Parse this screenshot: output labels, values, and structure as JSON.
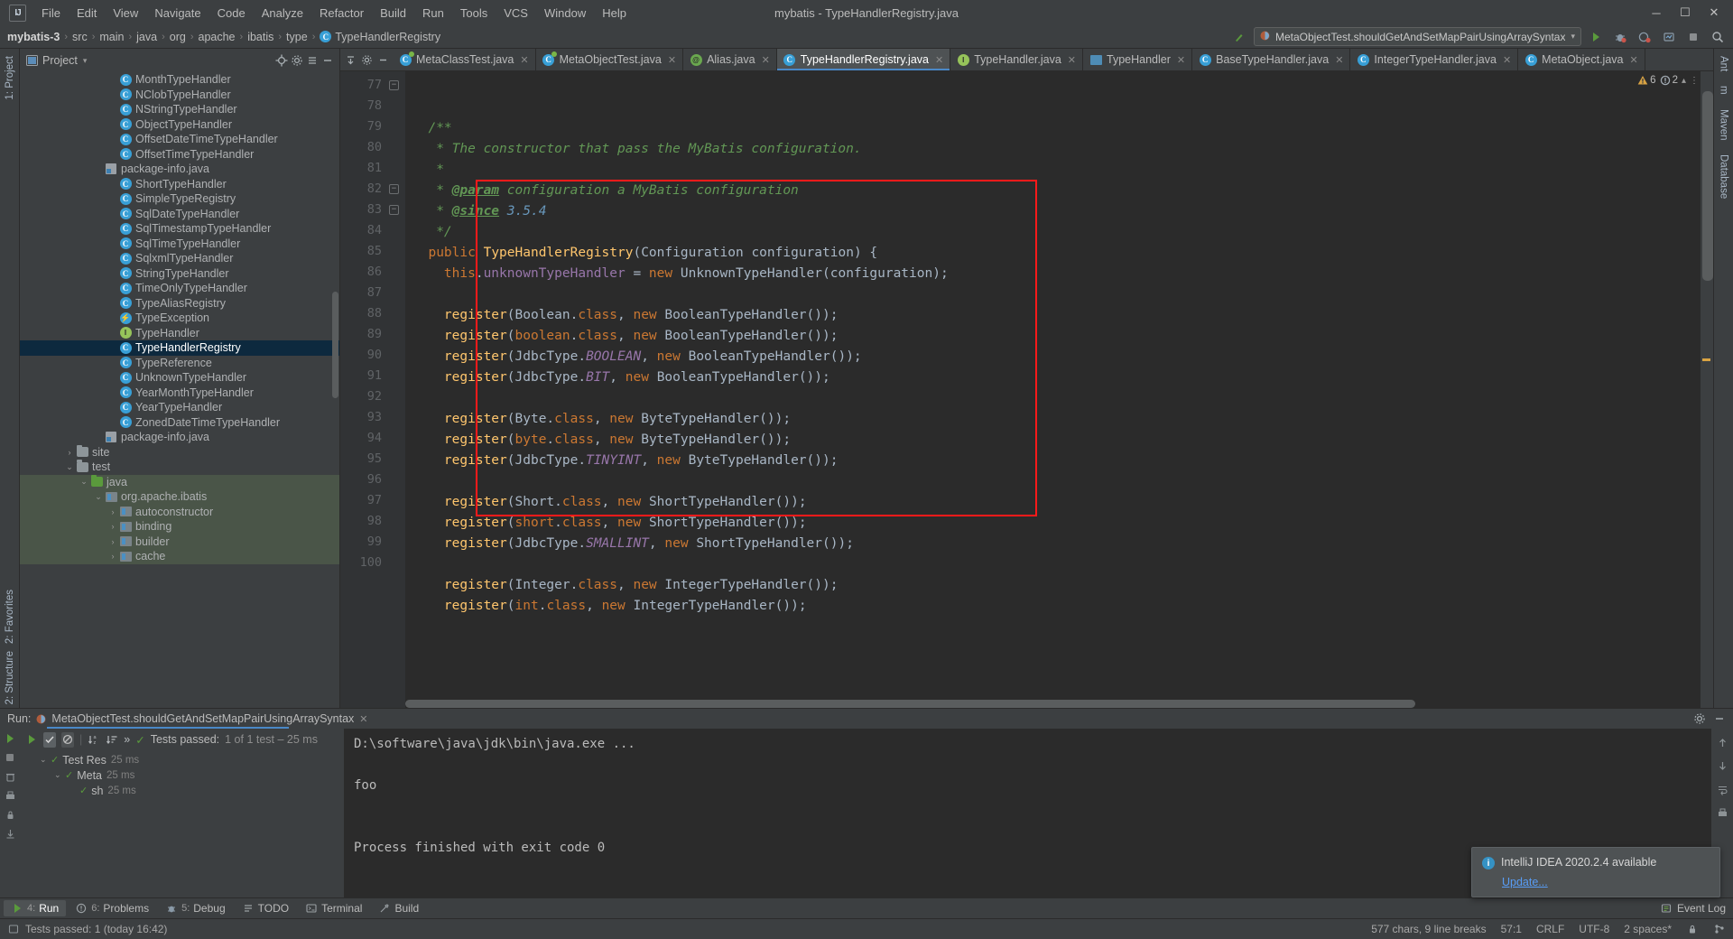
{
  "window": {
    "title": "mybatis - TypeHandlerRegistry.java",
    "logo": "IJ",
    "minimize": "─",
    "maximize": "☐",
    "close": "✕"
  },
  "menu": {
    "items": [
      "File",
      "Edit",
      "View",
      "Navigate",
      "Code",
      "Analyze",
      "Refactor",
      "Build",
      "Run",
      "Tools",
      "VCS",
      "Window",
      "Help"
    ]
  },
  "breadcrumb": {
    "items": [
      "mybatis-3",
      "src",
      "main",
      "java",
      "org",
      "apache",
      "ibatis",
      "type",
      "TypeHandlerRegistry"
    ],
    "separator": "›"
  },
  "run_config": {
    "name": "MetaObjectTest.shouldGetAndSetMapPairUsingArraySyntax",
    "caret": "▾",
    "run_icon": "run-icon",
    "debug_icon": "debug-icon",
    "coverage_icon": "coverage-icon",
    "profile_icon": "profile-icon",
    "stop_icon": "stop-icon",
    "search_icon": "search-icon"
  },
  "left_rail": {
    "top": [
      "1: Project"
    ],
    "bottom": [
      "2: Structure",
      "2: Favorites"
    ]
  },
  "right_rail": {
    "items": [
      "Ant",
      "m",
      "Maven",
      "Database"
    ]
  },
  "project_panel": {
    "title": "Project",
    "caret": "▾",
    "target_icon": "locate-icon",
    "settings_icon": "gear-icon",
    "collapse_icon": "collapse-all-icon",
    "hide_icon": "hide-icon",
    "tree": [
      {
        "label": "MonthTypeHandler",
        "icon": "class",
        "indent": 6,
        "arrow": ""
      },
      {
        "label": "NClobTypeHandler",
        "icon": "class",
        "indent": 6,
        "arrow": ""
      },
      {
        "label": "NStringTypeHandler",
        "icon": "class",
        "indent": 6,
        "arrow": ""
      },
      {
        "label": "ObjectTypeHandler",
        "icon": "class",
        "indent": 6,
        "arrow": ""
      },
      {
        "label": "OffsetDateTimeTypeHandler",
        "icon": "class",
        "indent": 6,
        "arrow": ""
      },
      {
        "label": "OffsetTimeTypeHandler",
        "icon": "class",
        "indent": 6,
        "arrow": ""
      },
      {
        "label": "package-info.java",
        "icon": "pkgjava",
        "indent": 5,
        "arrow": ""
      },
      {
        "label": "ShortTypeHandler",
        "icon": "class",
        "indent": 6,
        "arrow": ""
      },
      {
        "label": "SimpleTypeRegistry",
        "icon": "class",
        "indent": 6,
        "arrow": ""
      },
      {
        "label": "SqlDateTypeHandler",
        "icon": "class",
        "indent": 6,
        "arrow": ""
      },
      {
        "label": "SqlTimestampTypeHandler",
        "icon": "class",
        "indent": 6,
        "arrow": ""
      },
      {
        "label": "SqlTimeTypeHandler",
        "icon": "class",
        "indent": 6,
        "arrow": ""
      },
      {
        "label": "SqlxmlTypeHandler",
        "icon": "class",
        "indent": 6,
        "arrow": ""
      },
      {
        "label": "StringTypeHandler",
        "icon": "class",
        "indent": 6,
        "arrow": ""
      },
      {
        "label": "TimeOnlyTypeHandler",
        "icon": "class",
        "indent": 6,
        "arrow": ""
      },
      {
        "label": "TypeAliasRegistry",
        "icon": "class",
        "indent": 6,
        "arrow": ""
      },
      {
        "label": "TypeException",
        "icon": "exception",
        "indent": 6,
        "arrow": ""
      },
      {
        "label": "TypeHandler",
        "icon": "interface",
        "indent": 6,
        "arrow": ""
      },
      {
        "label": "TypeHandlerRegistry",
        "icon": "class",
        "indent": 6,
        "arrow": "",
        "selected": true
      },
      {
        "label": "TypeReference",
        "icon": "class",
        "indent": 6,
        "arrow": ""
      },
      {
        "label": "UnknownTypeHandler",
        "icon": "class",
        "indent": 6,
        "arrow": ""
      },
      {
        "label": "YearMonthTypeHandler",
        "icon": "class",
        "indent": 6,
        "arrow": ""
      },
      {
        "label": "YearTypeHandler",
        "icon": "class",
        "indent": 6,
        "arrow": ""
      },
      {
        "label": "ZonedDateTimeTypeHandler",
        "icon": "class",
        "indent": 6,
        "arrow": ""
      },
      {
        "label": "package-info.java",
        "icon": "pkgjava",
        "indent": 5,
        "arrow": ""
      },
      {
        "label": "site",
        "icon": "folder",
        "indent": 3,
        "arrow": "›"
      },
      {
        "label": "test",
        "icon": "folder",
        "indent": 3,
        "arrow": "⌄"
      },
      {
        "label": "java",
        "icon": "folder-green",
        "indent": 4,
        "arrow": "⌄",
        "srcroot": true
      },
      {
        "label": "org.apache.ibatis",
        "icon": "pkg",
        "indent": 5,
        "arrow": "⌄",
        "srcroot": true
      },
      {
        "label": "autoconstructor",
        "icon": "pkg",
        "indent": 6,
        "arrow": "›",
        "srcroot": true
      },
      {
        "label": "binding",
        "icon": "pkg",
        "indent": 6,
        "arrow": "›",
        "srcroot": true
      },
      {
        "label": "builder",
        "icon": "pkg",
        "indent": 6,
        "arrow": "›",
        "srcroot": true
      },
      {
        "label": "cache",
        "icon": "pkg",
        "indent": 6,
        "arrow": "›",
        "srcroot": true
      }
    ]
  },
  "editor": {
    "tabs": [
      {
        "label": "MetaClassTest.java",
        "icon": "test-class",
        "active": false
      },
      {
        "label": "MetaObjectTest.java",
        "icon": "test-class",
        "active": false
      },
      {
        "label": "Alias.java",
        "icon": "annotation",
        "active": false
      },
      {
        "label": "TypeHandlerRegistry.java",
        "icon": "class",
        "active": true
      },
      {
        "label": "TypeHandler.java",
        "icon": "interface",
        "active": false
      },
      {
        "label": "TypeHandler",
        "icon": "xml",
        "active": false
      },
      {
        "label": "BaseTypeHandler.java",
        "icon": "class",
        "active": false
      },
      {
        "label": "IntegerTypeHandler.java",
        "icon": "class",
        "active": false
      },
      {
        "label": "MetaObject.java",
        "icon": "class",
        "active": false
      }
    ],
    "tab_close": "✕",
    "inspections": {
      "warnings": "6",
      "weak_warnings": "2",
      "ok_mark": "✓"
    },
    "line_numbers": [
      "77",
      "78",
      "79",
      "80",
      "81",
      "82",
      "83",
      "84",
      "85",
      "86",
      "87",
      "88",
      "89",
      "90",
      "91",
      "92",
      "93",
      "94",
      "95",
      "96",
      "97",
      "98",
      "99",
      "100"
    ],
    "lines": [
      {
        "n": "77",
        "text": "  /**"
      },
      {
        "n": "78",
        "text": "   * The constructor that pass the MyBatis configuration."
      },
      {
        "n": "79",
        "text": "   *"
      },
      {
        "n": "80",
        "text": "   * @param configuration a MyBatis configuration"
      },
      {
        "n": "81",
        "text": "   * @since 3.5.4"
      },
      {
        "n": "82",
        "text": "   */"
      },
      {
        "n": "83",
        "text": "  public TypeHandlerRegistry(Configuration configuration) {"
      },
      {
        "n": "84",
        "text": "    this.unknownTypeHandler = new UnknownTypeHandler(configuration);"
      },
      {
        "n": "85",
        "text": ""
      },
      {
        "n": "86",
        "text": "    register(Boolean.class, new BooleanTypeHandler());"
      },
      {
        "n": "87",
        "text": "    register(boolean.class, new BooleanTypeHandler());"
      },
      {
        "n": "88",
        "text": "    register(JdbcType.BOOLEAN, new BooleanTypeHandler());"
      },
      {
        "n": "89",
        "text": "    register(JdbcType.BIT, new BooleanTypeHandler());"
      },
      {
        "n": "90",
        "text": ""
      },
      {
        "n": "91",
        "text": "    register(Byte.class, new ByteTypeHandler());"
      },
      {
        "n": "92",
        "text": "    register(byte.class, new ByteTypeHandler());"
      },
      {
        "n": "93",
        "text": "    register(JdbcType.TINYINT, new ByteTypeHandler());"
      },
      {
        "n": "94",
        "text": ""
      },
      {
        "n": "95",
        "text": "    register(Short.class, new ShortTypeHandler());"
      },
      {
        "n": "96",
        "text": "    register(short.class, new ShortTypeHandler());"
      },
      {
        "n": "97",
        "text": "    register(JdbcType.SMALLINT, new ShortTypeHandler());"
      },
      {
        "n": "98",
        "text": ""
      },
      {
        "n": "99",
        "text": "    register(Integer.class, new IntegerTypeHandler());"
      },
      {
        "n": "100",
        "text": "    register(int.class, new IntegerTypeHandler());"
      }
    ]
  },
  "run_panel": {
    "label": "Run:",
    "config_name": "MetaObjectTest.shouldGetAndSetMapPairUsingArraySyntax",
    "close": "✕",
    "settings_icon": "gear-icon",
    "hide_icon": "hide-icon",
    "status": "Tests passed:",
    "status_detail": "1 of 1 test – 25 ms",
    "sort_alpha_icon": "sort-alphabetically-icon",
    "sort_duration_icon": "sort-by-duration-icon",
    "more_icon": "»",
    "rerun_icon": "rerun-icon",
    "toggle_passed_icon": "show-passed-icon",
    "toggle_ignored_icon": "hide-ignored-icon",
    "test_tree": [
      {
        "label": "Test Res",
        "duration": "25 ms",
        "indent": 1,
        "arrow": "⌄"
      },
      {
        "label": "Meta",
        "duration": "25 ms",
        "indent": 2,
        "arrow": "⌄"
      },
      {
        "label": "sh",
        "duration": "25 ms",
        "indent": 3,
        "arrow": ""
      }
    ],
    "console": [
      "D:\\software\\java\\jdk\\bin\\java.exe ...",
      "",
      "foo",
      "",
      "",
      "Process finished with exit code 0"
    ]
  },
  "notification": {
    "title": "IntelliJ IDEA 2020.2.4 available",
    "link": "Update...",
    "info_glyph": "i"
  },
  "bottom_tabs": [
    {
      "label": "Run",
      "num": "4:",
      "icon": "run-icon",
      "active": true
    },
    {
      "label": "Problems",
      "num": "6:",
      "icon": "problems-icon",
      "active": false
    },
    {
      "label": "Debug",
      "num": "5:",
      "icon": "debug-icon",
      "active": false
    },
    {
      "label": "TODO",
      "num": "",
      "icon": "todo-icon",
      "active": false
    },
    {
      "label": "Terminal",
      "num": "",
      "icon": "terminal-icon",
      "active": false
    },
    {
      "label": "Build",
      "num": "",
      "icon": "build-icon",
      "active": false
    }
  ],
  "event_log": {
    "label": "Event Log",
    "icon": "event-log-icon"
  },
  "statusbar": {
    "message": "Tests passed: 1 (today 16:42)",
    "chars": "577 chars, 9 line breaks",
    "caret": "57:1",
    "line_sep": "CRLF",
    "encoding": "UTF-8",
    "indent": "2 spaces*",
    "lock_icon": "lock-icon",
    "branch_icon": "branch-icon"
  },
  "colors": {
    "accent": "#4a88c7",
    "selection": "#0d293e",
    "redbox": "#ff1a1a",
    "editor_bg": "#2b2b2b",
    "panel_bg": "#3c3f41",
    "green": "#5a9a3c",
    "link": "#589df6"
  }
}
